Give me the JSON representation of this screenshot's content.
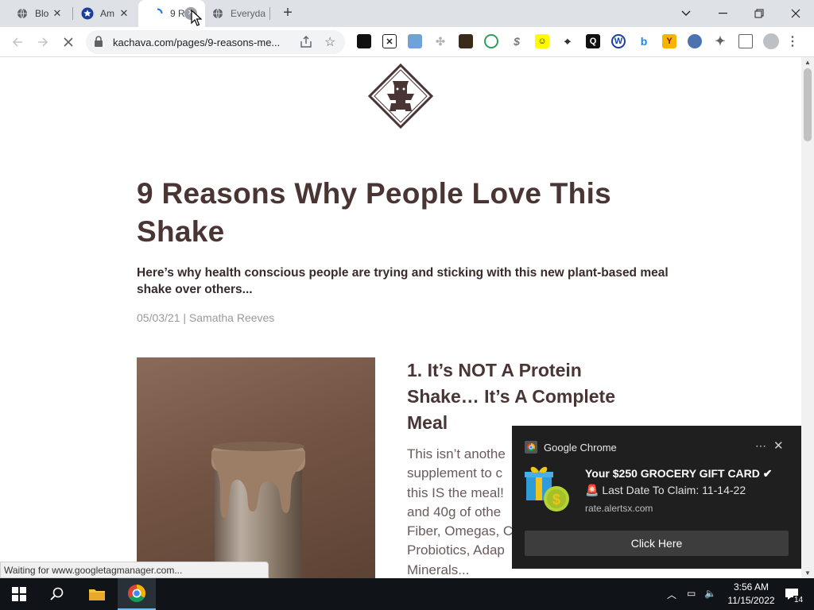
{
  "browser": {
    "tabs": [
      {
        "title": "Blo",
        "icon": "globe-icon"
      },
      {
        "title": "Am",
        "icon": "blue-star-icon"
      },
      {
        "title": "9 R",
        "icon": "loading-spinner-icon",
        "active": true
      },
      {
        "title": "Everyda",
        "icon": "globe-icon"
      }
    ],
    "new_tab_label": "+",
    "url": "kachava.com/pages/9-reasons-me...",
    "window_controls": [
      "chevron-down-icon",
      "minimize-icon",
      "restore-icon",
      "close-icon"
    ],
    "extensions": [
      "ext-black-square",
      "ext-xbox",
      "ext-photo",
      "ext-puzzle-grey",
      "ext-film",
      "ext-green-circle",
      "ext-dollar",
      "ext-snapchat",
      "ext-location",
      "ext-q",
      "ext-wordpress",
      "ext-bing",
      "ext-y",
      "ext-globe",
      "extensions-puzzle-icon",
      "side-panel-icon",
      "profile-icon",
      "menu-kebab-icon"
    ]
  },
  "page": {
    "title": "9 Reasons Why People Love This Shake",
    "subtitle": "Here’s why health conscious people are trying and sticking with this new plant-based meal shake over others...",
    "meta": "05/03/21 | Samatha Reeves",
    "section1": {
      "heading": "1. It’s NOT A Protein Shake… It’s A Complete Meal",
      "body_lines": [
        "This isn’t anothe",
        "supplement to c",
        "this IS the meal!",
        "and 40g of othe",
        "Fiber, Omegas, C",
        "Probiotics, Adap",
        "Minerals..."
      ]
    }
  },
  "status_bar": "Waiting for www.googletagmanager.com...",
  "notification": {
    "app": "Google Chrome",
    "title": "Your $250 GROCERY GIFT CARD ✔",
    "line2": "🚨 Last Date To Claim: 11-14-22",
    "source": "rate.alertsx.com",
    "button": "Click Here"
  },
  "taskbar": {
    "time": "3:56 AM",
    "date": "11/15/2022",
    "notification_count": "14"
  }
}
